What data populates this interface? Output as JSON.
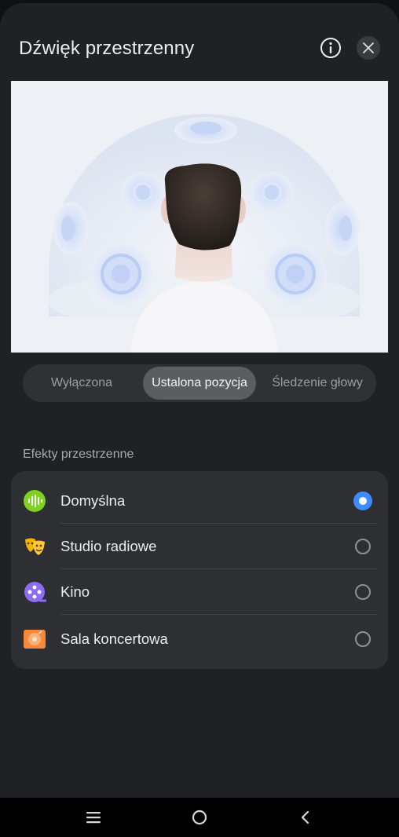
{
  "dialog": {
    "title": "Dźwięk przestrzenny",
    "info_icon": "info-circle-icon",
    "close_icon": "close-icon"
  },
  "modes": {
    "tabs": [
      {
        "label": "Wyłączona",
        "selected": false
      },
      {
        "label": "Ustalona pozycja",
        "selected": true
      },
      {
        "label": "Śledzenie głowy",
        "selected": false
      }
    ]
  },
  "effects": {
    "section_title": "Efekty przestrzenne",
    "items": [
      {
        "label": "Domyślna",
        "icon": "sound-wave-icon",
        "icon_color": "#7ed321",
        "selected": true
      },
      {
        "label": "Studio radiowe",
        "icon": "theater-masks-icon",
        "icon_color": "#f5b400",
        "selected": false
      },
      {
        "label": "Kino",
        "icon": "film-reel-icon",
        "icon_color": "#8c6cf2",
        "selected": false
      },
      {
        "label": "Sala koncertowa",
        "icon": "concert-hall-icon",
        "icon_color": "#f58a3a",
        "selected": false
      }
    ]
  },
  "colors": {
    "accent": "#3e8bff",
    "background": "#202124",
    "card": "#2e2f32"
  },
  "navigation": {
    "recents_icon": "recents-icon",
    "home_icon": "home-icon",
    "back_icon": "back-icon"
  }
}
